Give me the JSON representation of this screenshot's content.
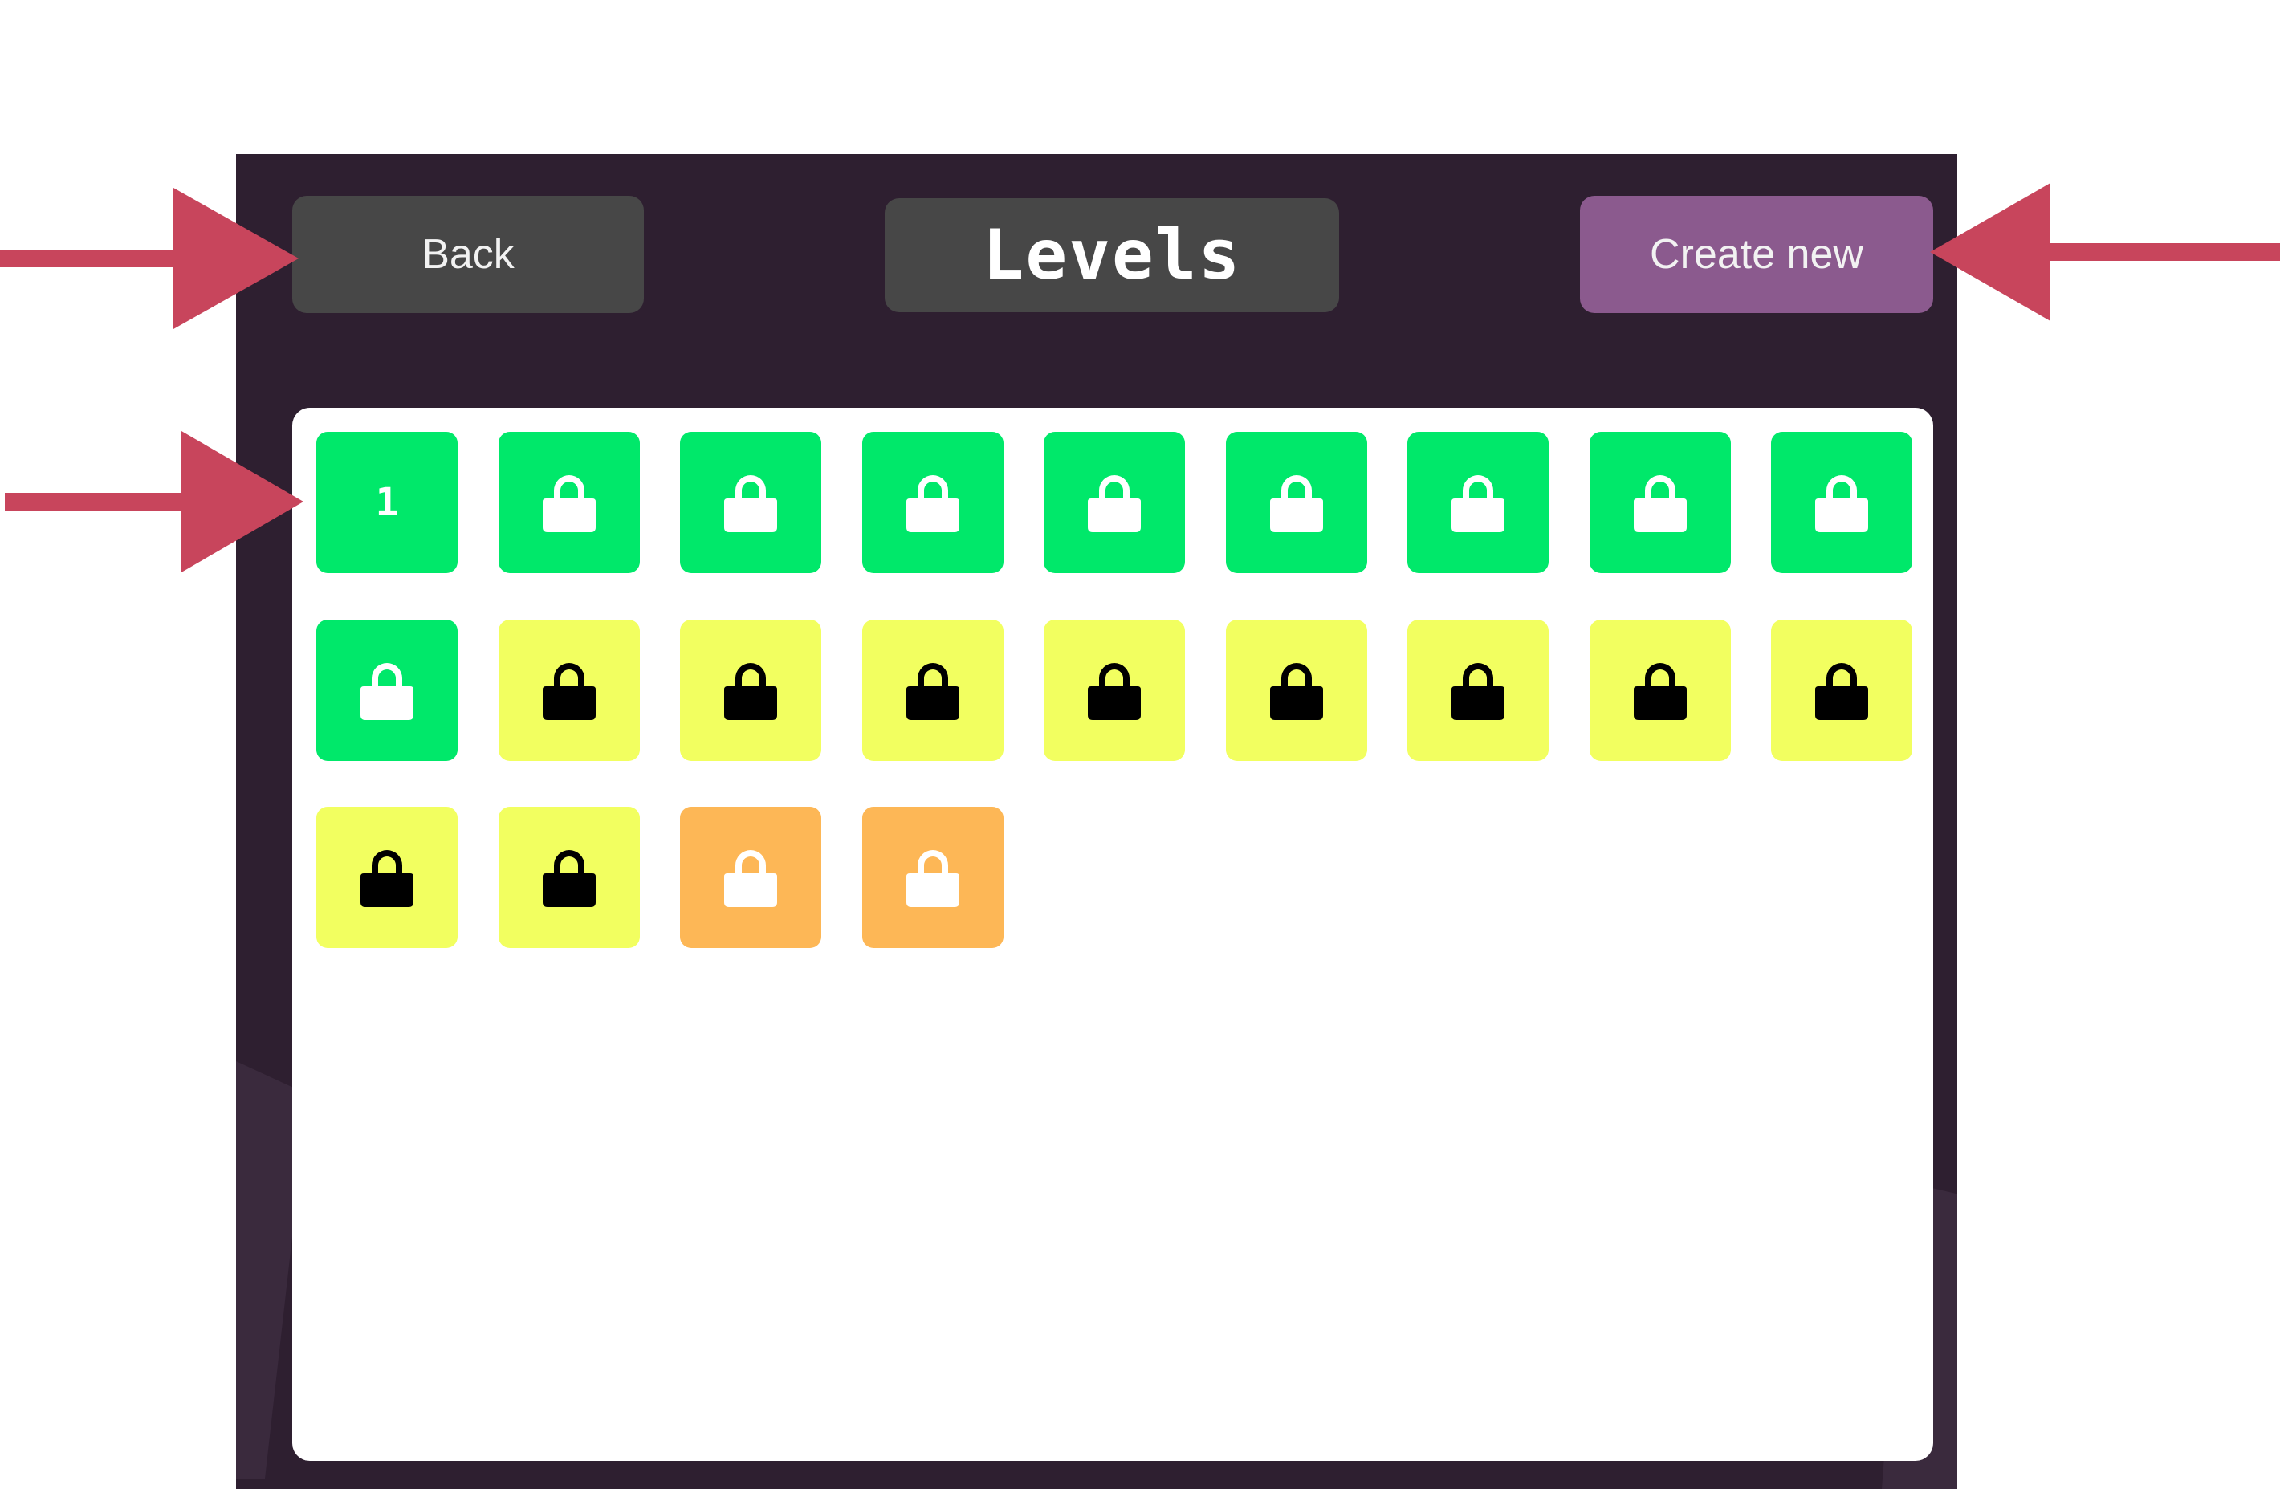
{
  "header": {
    "back_label": "Back",
    "title": "Levels",
    "create_label": "Create new"
  },
  "levels": [
    {
      "label": "1",
      "locked": false,
      "color": "green"
    },
    {
      "label": "",
      "locked": true,
      "color": "green"
    },
    {
      "label": "",
      "locked": true,
      "color": "green"
    },
    {
      "label": "",
      "locked": true,
      "color": "green"
    },
    {
      "label": "",
      "locked": true,
      "color": "green"
    },
    {
      "label": "",
      "locked": true,
      "color": "green"
    },
    {
      "label": "",
      "locked": true,
      "color": "green"
    },
    {
      "label": "",
      "locked": true,
      "color": "green"
    },
    {
      "label": "",
      "locked": true,
      "color": "green"
    },
    {
      "label": "",
      "locked": true,
      "color": "green"
    },
    {
      "label": "",
      "locked": true,
      "color": "yellow"
    },
    {
      "label": "",
      "locked": true,
      "color": "yellow"
    },
    {
      "label": "",
      "locked": true,
      "color": "yellow"
    },
    {
      "label": "",
      "locked": true,
      "color": "yellow"
    },
    {
      "label": "",
      "locked": true,
      "color": "yellow"
    },
    {
      "label": "",
      "locked": true,
      "color": "yellow"
    },
    {
      "label": "",
      "locked": true,
      "color": "yellow"
    },
    {
      "label": "",
      "locked": true,
      "color": "yellow"
    },
    {
      "label": "",
      "locked": true,
      "color": "yellow"
    },
    {
      "label": "",
      "locked": true,
      "color": "yellow"
    },
    {
      "label": "",
      "locked": true,
      "color": "orange"
    },
    {
      "label": "",
      "locked": true,
      "color": "orange"
    }
  ],
  "colors": {
    "window_bg": "#2e1f30",
    "button_gray": "#474747",
    "button_purple": "#8b5a8e",
    "tile_green": "#00e86a",
    "tile_yellow": "#f2ff60",
    "tile_orange": "#fdb756",
    "annotation_arrow": "#c8455c"
  },
  "icons": {
    "lock": "lock-icon",
    "arrow": "arrow-right-icon"
  }
}
